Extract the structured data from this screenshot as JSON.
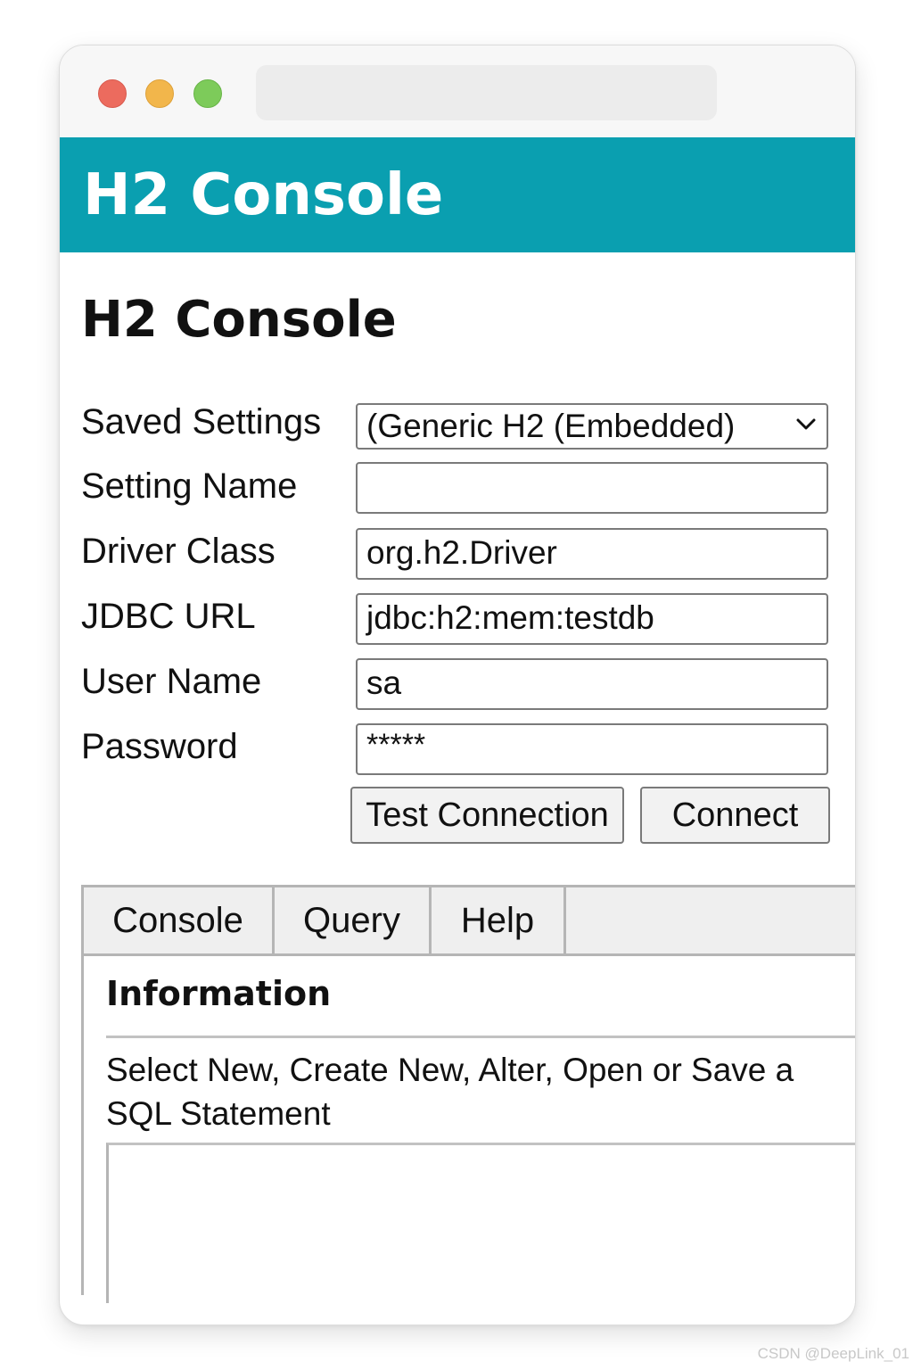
{
  "app": {
    "header_title": "H2 Console",
    "page_heading": "H2 Console"
  },
  "colors": {
    "header_bg": "#0a9fb0",
    "close_dot": "#ec6b5e",
    "minimize_dot": "#f2b64b",
    "maximize_dot": "#7dcb5a"
  },
  "window": {
    "controls": [
      "close",
      "minimize",
      "maximize"
    ],
    "address_bar_value": ""
  },
  "login_form": {
    "saved_settings": {
      "label": "Saved Settings",
      "selected": "(Generic H2 (Embedded)",
      "icon": "chevron-down-icon"
    },
    "setting_name": {
      "label": "Setting Name",
      "value": ""
    },
    "driver_class": {
      "label": "Driver Class",
      "value": "org.h2.Driver"
    },
    "jdbc_url": {
      "label": "JDBC URL",
      "value": "jdbc:h2:mem:testdb"
    },
    "user_name": {
      "label": "User Name",
      "value": "sa"
    },
    "password": {
      "label": "Password",
      "value": "*****"
    },
    "buttons": {
      "test_connection": "Test Connection",
      "connect": "Connect"
    }
  },
  "console_panel": {
    "tabs": [
      {
        "label": "Console"
      },
      {
        "label": "Query"
      },
      {
        "label": "Help"
      }
    ],
    "info_title": "Information",
    "info_text": "Select New, Create New, Alter, Open or Save a SQL Statement",
    "sql_editor_value": ""
  },
  "watermark": "CSDN @DeepLink_01"
}
